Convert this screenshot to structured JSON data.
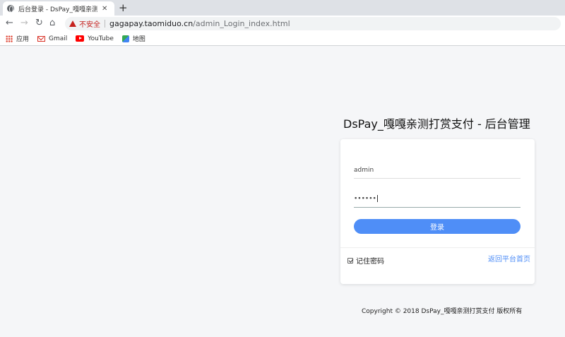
{
  "browser": {
    "tab_title": "后台登录 - DsPay_嘎嘎亲测打赏",
    "tab_close": "✕",
    "new_tab": "+",
    "nav": {
      "back": "←",
      "forward": "→",
      "reload": "↻",
      "home": "⌂"
    },
    "security_label": "不安全",
    "url_host": "gagapay.taomiduo.cn",
    "url_path": "/admin_Login_index.html",
    "bookmarks": [
      {
        "label": "应用",
        "icon": "apps-grid-icon"
      },
      {
        "label": "Gmail",
        "icon": "gmail-icon"
      },
      {
        "label": "YouTube",
        "icon": "youtube-icon"
      },
      {
        "label": "地图",
        "icon": "maps-icon"
      }
    ]
  },
  "page": {
    "title": "DsPay_嘎嘎亲测打赏支付 - 后台管理",
    "username_value": "admin",
    "password_value": "••••••",
    "login_button": "登录",
    "remember_label": "记住密码",
    "remember_checked": true,
    "back_link": "返回平台首页",
    "copyright": "Copyright © 2018 DsPay_嘎嘎亲测打赏支付 版权所有"
  },
  "colors": {
    "accent": "#4f8ef7",
    "warning": "#c5221f",
    "background": "#f5f6f8"
  }
}
